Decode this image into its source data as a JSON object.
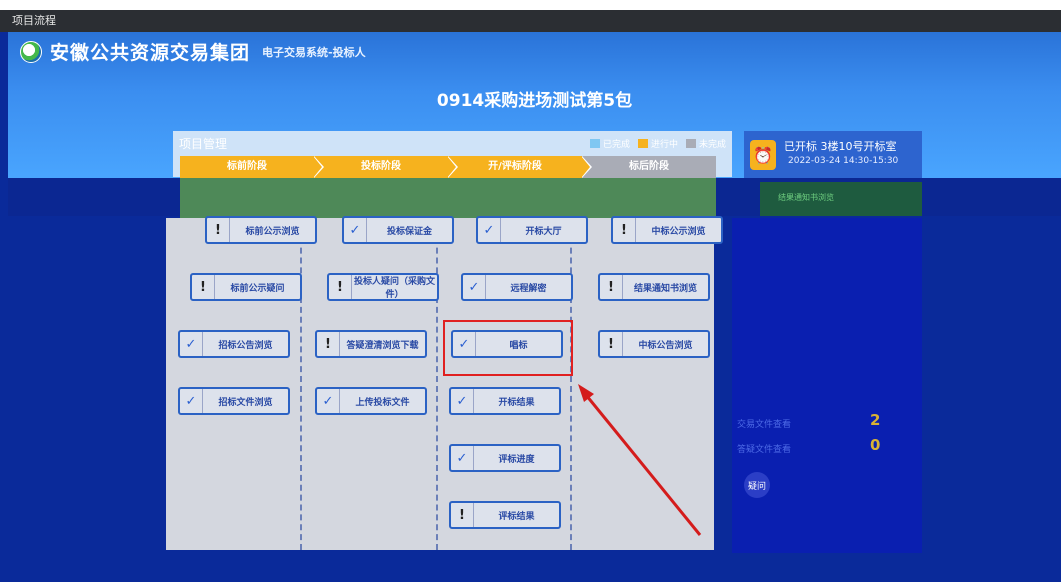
{
  "window": {
    "title": "项目流程"
  },
  "header": {
    "org_name": "安徽公共资源交易集团",
    "system_name": "电子交易系统-投标人"
  },
  "project": {
    "title": "0914采购进场测试第5包"
  },
  "panel": {
    "title": "项目管理",
    "legend": [
      {
        "label": "已完成",
        "color": "#7fc7f2"
      },
      {
        "label": "进行中",
        "color": "#f6b21e"
      },
      {
        "label": "未完成",
        "color": "#a9acb6"
      }
    ]
  },
  "stages": [
    "标前阶段",
    "投标阶段",
    "开/评标阶段",
    "标后阶段"
  ],
  "open_info": {
    "status": "已开标 3楼10号开标室",
    "time": "2022-03-24 14:30-15:30"
  },
  "side_link": {
    "label": "结果通知书浏览"
  },
  "columns": [
    {
      "buttons": [
        {
          "label": "标前公示浏览",
          "icon": "exclamation-icon"
        },
        {
          "label": "标前公示疑问",
          "icon": "exclamation-icon"
        },
        {
          "label": "招标公告浏览",
          "icon": "check-icon"
        },
        {
          "label": "招标文件浏览",
          "icon": "check-icon"
        }
      ]
    },
    {
      "buttons": [
        {
          "label": "投标保证金",
          "icon": "check-icon"
        },
        {
          "label": "投标人疑问（采购文件）",
          "icon": "exclamation-icon"
        },
        {
          "label": "答疑澄清浏览下载",
          "icon": "exclamation-icon"
        },
        {
          "label": "上传投标文件",
          "icon": "check-icon"
        }
      ]
    },
    {
      "buttons": [
        {
          "label": "开标大厅",
          "icon": "check-icon"
        },
        {
          "label": "远程解密",
          "icon": "check-icon"
        },
        {
          "label": "唱标",
          "icon": "check-icon"
        },
        {
          "label": "开标结果",
          "icon": "check-icon"
        },
        {
          "label": "评标进度",
          "icon": "check-icon"
        },
        {
          "label": "评标结果",
          "icon": "exclamation-icon"
        }
      ]
    },
    {
      "buttons": [
        {
          "label": "中标公示浏览",
          "icon": "exclamation-icon"
        },
        {
          "label": "结果通知书浏览",
          "icon": "exclamation-icon"
        },
        {
          "label": "中标公告浏览",
          "icon": "exclamation-icon"
        }
      ]
    }
  ],
  "stats": [
    {
      "label": "交易文件查看",
      "value": "2"
    },
    {
      "label": "答疑文件查看",
      "value": "0"
    }
  ],
  "question_button": {
    "label": "疑问"
  }
}
